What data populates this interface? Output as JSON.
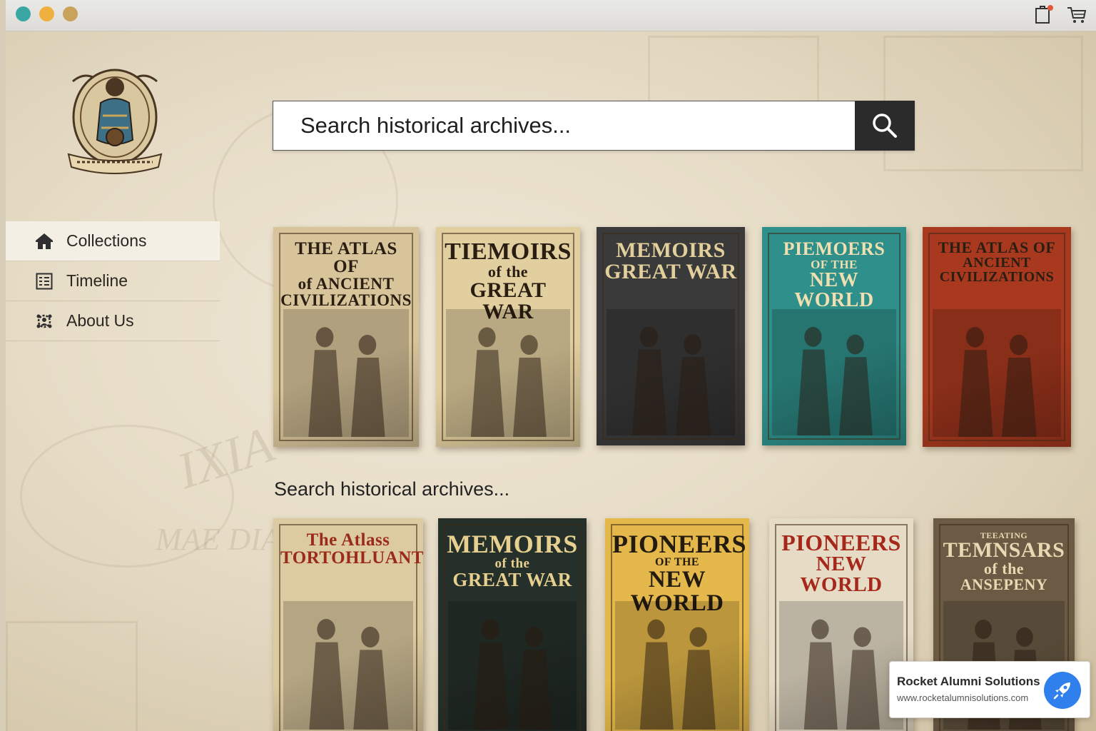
{
  "window": {
    "controls": [
      "teal",
      "amber",
      "gold"
    ],
    "right_icons": [
      "clipboard-icon",
      "cart-icon"
    ]
  },
  "logo": {
    "name": "archive-emblem",
    "alt": ""
  },
  "sidebar": {
    "items": [
      {
        "label": "Collections",
        "icon": "home-icon",
        "active": true
      },
      {
        "label": "Timeline",
        "icon": "timeline-icon",
        "active": false
      },
      {
        "label": "About Us",
        "icon": "people-icon",
        "active": false
      }
    ]
  },
  "search": {
    "placeholder": "Search historical archives...",
    "button_icon": "search-icon"
  },
  "row1": [
    {
      "lines": [
        "THE ATLAS OF",
        "of ANCIENT",
        "CIVILIZATIONS"
      ],
      "bg": "#d8c49a",
      "fg": "#2a1e12"
    },
    {
      "lines": [
        "TIEMOIRS",
        "of the",
        "GREAT WAR"
      ],
      "bg": "#e2cf9f",
      "fg": "#2a1e12"
    },
    {
      "lines": [
        "MEMOIRS",
        "GREAT WAR"
      ],
      "bg": "#3a3a3a",
      "fg": "#e3cf9b"
    },
    {
      "lines": [
        "PIEMOERS",
        "OF THE",
        "NEW WORLD"
      ],
      "bg": "#2f8f8a",
      "fg": "#f0dfb0"
    },
    {
      "lines": [
        "THE ATLAS OF",
        "ANCIENT",
        "CIVILIZATIONS"
      ],
      "bg": "#a8391f",
      "fg": "#2a1e12"
    }
  ],
  "section": {
    "label": "Search historical archives..."
  },
  "row2": [
    {
      "lines": [
        "The Atlass",
        "TORTOHLUANTES"
      ],
      "bg": "#dccaa0",
      "fg": "#9a2a1a"
    },
    {
      "lines": [
        "MEMOIRS",
        "of the",
        "GREAT WAR"
      ],
      "bg": "#26302a",
      "fg": "#e6cf8f"
    },
    {
      "lines": [
        "PIONEERS",
        "OF THE",
        "NEW WORLD"
      ],
      "bg": "#e4b84a",
      "fg": "#231a10"
    },
    {
      "lines": [
        "PIONEERS",
        "NEW WORLD"
      ],
      "bg": "#e6dcc6",
      "fg": "#a5281a"
    },
    {
      "lines": [
        "TEEATING",
        "TEMNSARS",
        "of the",
        "ANSEPENY"
      ],
      "bg": "#6b5b45",
      "fg": "#e8d9b2"
    }
  ],
  "toast": {
    "title": "Rocket Alumni Solutions",
    "url": "www.rocketalumnisolutions.com",
    "icon": "rocket-icon"
  },
  "colors": {
    "search_button": "#2b2b2b",
    "page_background": "#e6dcc6",
    "toast_icon": "#2f80ed"
  }
}
